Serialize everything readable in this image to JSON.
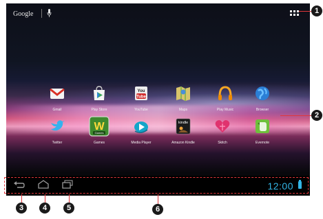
{
  "search_bar": {
    "google_label": "Google"
  },
  "apps": [
    {
      "label": "Gmail",
      "icon": "gmail-icon"
    },
    {
      "label": "Play Store",
      "icon": "play-store-icon"
    },
    {
      "label": "YouTube",
      "icon": "youtube-icon",
      "glyph": "You Tube"
    },
    {
      "label": "Maps",
      "icon": "maps-icon"
    },
    {
      "label": "Play Music",
      "icon": "headphones-icon"
    },
    {
      "label": "Browser",
      "icon": "globe-icon"
    },
    {
      "label": "Twitter",
      "icon": "twitter-bird-icon"
    },
    {
      "label": "Games",
      "icon": "games-icon",
      "glyph": "W",
      "sub": "Games"
    },
    {
      "label": "Media Player",
      "icon": "media-player-icon"
    },
    {
      "label": "Amazon Kindle",
      "icon": "kindle-icon",
      "glyph": "kindle"
    },
    {
      "label": "Skitch",
      "icon": "skitch-heart-icon"
    },
    {
      "label": "Evernote",
      "icon": "evernote-icon"
    }
  ],
  "status_bar": {
    "clock": "12:00"
  },
  "callouts": [
    "1",
    "2",
    "3",
    "4",
    "5",
    "6"
  ],
  "colors": {
    "accent_clock": "#33b5e5",
    "callout_line": "#e2373b"
  }
}
